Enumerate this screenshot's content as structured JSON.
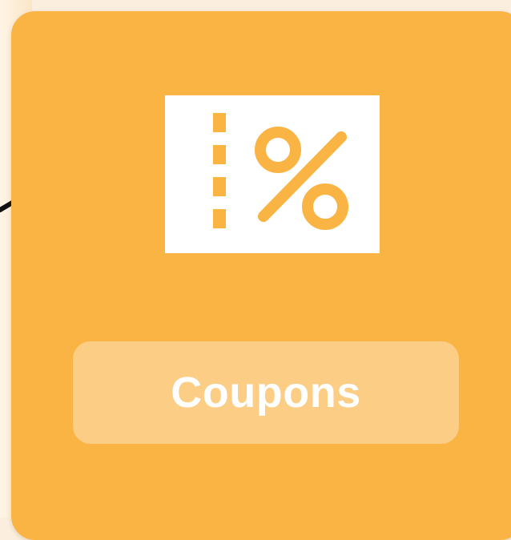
{
  "card": {
    "label": "Coupons",
    "icon": "coupon-percent-icon"
  },
  "colors": {
    "card_background": "#f9b443",
    "pill_background": "#fbcd85",
    "icon_color": "#ffffff",
    "label_color": "#ffffff",
    "connector_color": "#000000"
  }
}
